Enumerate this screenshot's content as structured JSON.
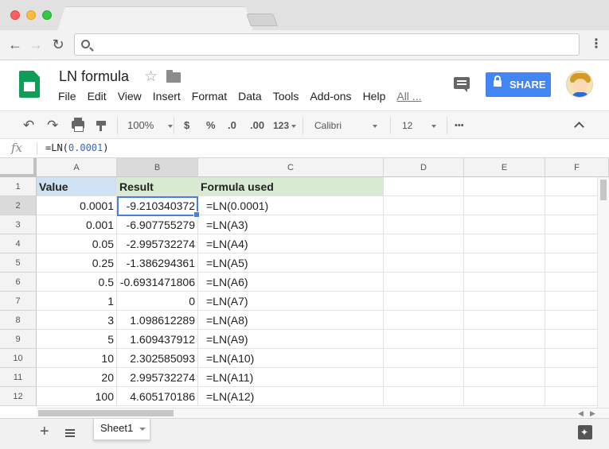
{
  "document": {
    "title": "LN formula"
  },
  "menu": [
    "File",
    "Edit",
    "View",
    "Insert",
    "Format",
    "Data",
    "Tools",
    "Add-ons",
    "Help",
    "All ..."
  ],
  "share_label": "SHARE",
  "toolbar": {
    "zoom": "100%",
    "currency": "$",
    "percent": "%",
    "dec_decrease": ".0",
    "dec_increase": ".00",
    "more_formats": "123",
    "font": "Calibri",
    "font_size": "12",
    "more": "•••"
  },
  "formula_bar": {
    "fx": "fx",
    "prefix": "=LN(",
    "number": "0.0001",
    "suffix": ")"
  },
  "columns": [
    "A",
    "B",
    "C",
    "D",
    "E",
    "F"
  ],
  "rows": [
    {
      "n": "1",
      "a": "Value",
      "b": "Result",
      "c": "Formula used"
    },
    {
      "n": "2",
      "a": "0.0001",
      "b": "-9.210340372",
      "c": "=LN(0.0001)"
    },
    {
      "n": "3",
      "a": "0.001",
      "b": "-6.907755279",
      "c": "=LN(A3)"
    },
    {
      "n": "4",
      "a": "0.05",
      "b": "-2.995732274",
      "c": "=LN(A4)"
    },
    {
      "n": "5",
      "a": "0.25",
      "b": "-1.386294361",
      "c": "=LN(A5)"
    },
    {
      "n": "6",
      "a": "0.5",
      "b": "-0.6931471806",
      "c": "=LN(A6)"
    },
    {
      "n": "7",
      "a": "1",
      "b": "0",
      "c": "=LN(A7)"
    },
    {
      "n": "8",
      "a": "3",
      "b": "1.098612289",
      "c": "=LN(A8)"
    },
    {
      "n": "9",
      "a": "5",
      "b": "1.609437912",
      "c": "=LN(A9)"
    },
    {
      "n": "10",
      "a": "10",
      "b": "2.302585093",
      "c": "=LN(A10)"
    },
    {
      "n": "11",
      "a": "20",
      "b": "2.995732274",
      "c": "=LN(A11)"
    },
    {
      "n": "12",
      "a": "100",
      "b": "4.605170186",
      "c": "=LN(A12)"
    }
  ],
  "sheet_tab": "Sheet1",
  "colors": {
    "header_a": "#cfe2f3",
    "header_bc": "#d9ead3",
    "share": "#4285f4",
    "active_cell": "#4a7fe0"
  }
}
